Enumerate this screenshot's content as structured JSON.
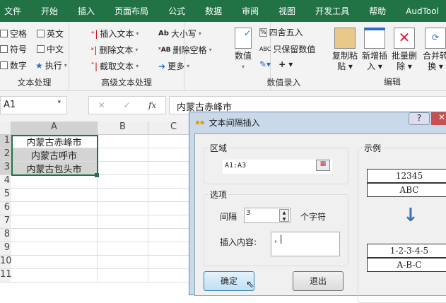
{
  "ribbon_tabs": [
    "文件",
    "开始",
    "插入",
    "页面布局",
    "公式",
    "数据",
    "审阅",
    "视图",
    "开发工具",
    "帮助",
    "AudTool"
  ],
  "text_processing": {
    "checkboxes": [
      "空格",
      "英文",
      "符号",
      "中文",
      "数字"
    ],
    "execute": "执行",
    "label": "文本处理"
  },
  "advanced": {
    "items": [
      "插入文本",
      "删除文本",
      "截取文本",
      "大小写",
      "删除空格",
      "更多"
    ],
    "label": "高级文本处理"
  },
  "number_entry": {
    "numeric": "数值",
    "round": "四舍五入",
    "keep_numbers": "只保留数值",
    "label": "数值录入"
  },
  "edit": {
    "buttons": [
      "复制粘贴",
      "新增插入",
      "批量删除",
      "合并转换"
    ],
    "label": "编辑"
  },
  "formula_bar": {
    "name_box": "A1",
    "formula": "内蒙古赤峰市"
  },
  "grid": {
    "columns": [
      "A",
      "B",
      "C"
    ],
    "rows": [
      "1",
      "2",
      "3",
      "4",
      "5",
      "6",
      "7",
      "8",
      "9",
      "10",
      "11"
    ],
    "cells": [
      "内蒙古赤峰市",
      "内蒙古呼市",
      "内蒙古包头市"
    ]
  },
  "dialog": {
    "title": "文本间隔插入",
    "range_label": "区域",
    "range_value": "A1:A3",
    "options_label": "选项",
    "interval_label": "间隔",
    "interval_value": "3",
    "interval_unit": "个字符",
    "insert_label": "插入内容:",
    "insert_value": ",",
    "example_label": "示例",
    "example_before": [
      "12345",
      "ABC"
    ],
    "example_after": [
      "1-2-3-4-5",
      "A-B-C"
    ],
    "ok": "确定",
    "exit": "退出",
    "help": "?"
  }
}
